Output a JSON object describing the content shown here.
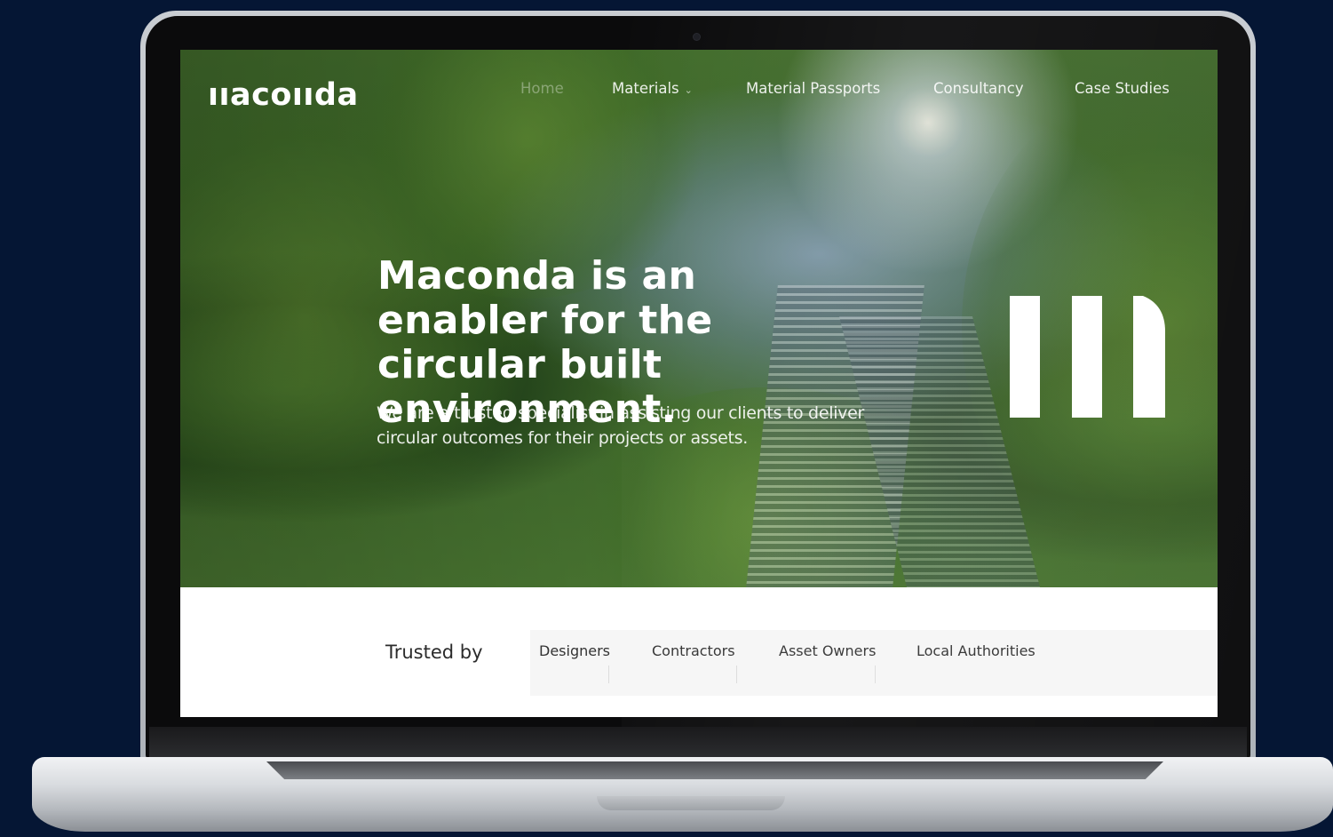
{
  "site": {
    "logo_text": "ııacoııda",
    "nav": {
      "home": "Home",
      "materials": "Materials",
      "materials_chevron": "⌄",
      "passports": "Material Passports",
      "consultancy": "Consultancy",
      "case_studies": "Case Studies"
    },
    "hero": {
      "headline": "Maconda is an enabler for the circular built environment.",
      "subline": "We are a trusted specialist in assisting our clients to deliver circular outcomes for their projects or assets."
    },
    "trusted": {
      "label": "Trusted by",
      "tabs": [
        "Designers",
        "Contractors",
        "Asset Owners",
        "Local Authorities"
      ]
    }
  },
  "colors": {
    "background": "#051634",
    "nav_text": "#ffffff",
    "home_faded": "rgba(255,255,255,0.35)",
    "panel": "#f6f6f6"
  },
  "icons": {
    "logo_mark": "maconda-m-mark",
    "materials_dropdown": "chevron-down-icon",
    "camera": "webcam-dot"
  }
}
